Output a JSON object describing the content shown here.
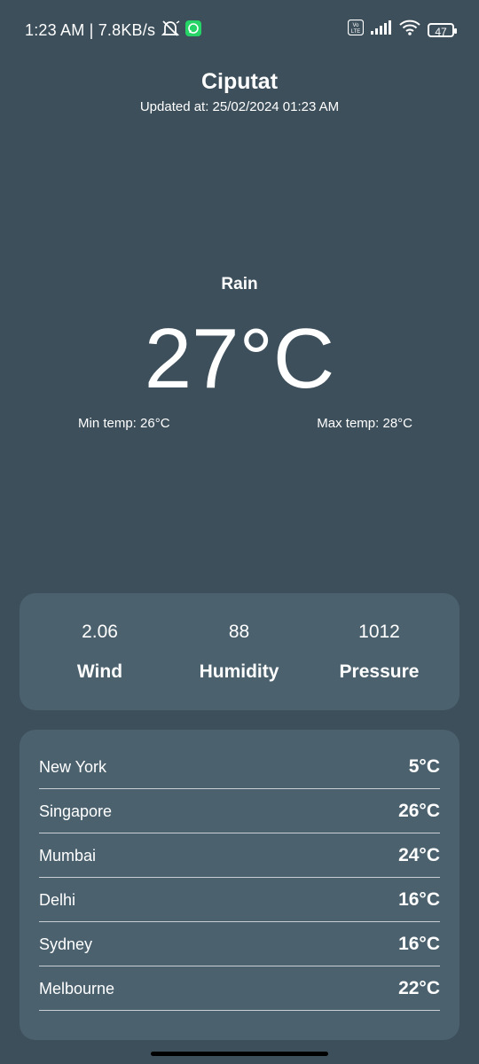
{
  "status_bar": {
    "time_speed": "1:23 AM | 7.8KB/s",
    "battery": "47",
    "volte_label": "Vo\nLTE"
  },
  "weather": {
    "city": "Ciputat",
    "updated": "Updated at: 25/02/2024 01:23 AM",
    "condition": "Rain",
    "temp": "27°C",
    "min_temp": "Min temp: 26°C",
    "max_temp": "Max temp: 28°C"
  },
  "stats": [
    {
      "value": "2.06",
      "label": "Wind"
    },
    {
      "value": "88",
      "label": "Humidity"
    },
    {
      "value": "1012",
      "label": "Pressure"
    }
  ],
  "cities": [
    {
      "name": "New York",
      "temp": "5°C"
    },
    {
      "name": "Singapore",
      "temp": "26°C"
    },
    {
      "name": "Mumbai",
      "temp": "24°C"
    },
    {
      "name": "Delhi",
      "temp": "16°C"
    },
    {
      "name": "Sydney",
      "temp": "16°C"
    },
    {
      "name": "Melbourne",
      "temp": "22°C"
    }
  ],
  "colors": {
    "background": "#3d4f5b",
    "card": "#4b616e",
    "whatsapp": "#25d366"
  },
  "icons": {
    "mute": "bell-slash-icon",
    "app": "whatsapp-icon",
    "volte": "volte-icon",
    "signal": "signal-icon",
    "wifi": "wifi-icon",
    "battery": "battery-icon"
  }
}
